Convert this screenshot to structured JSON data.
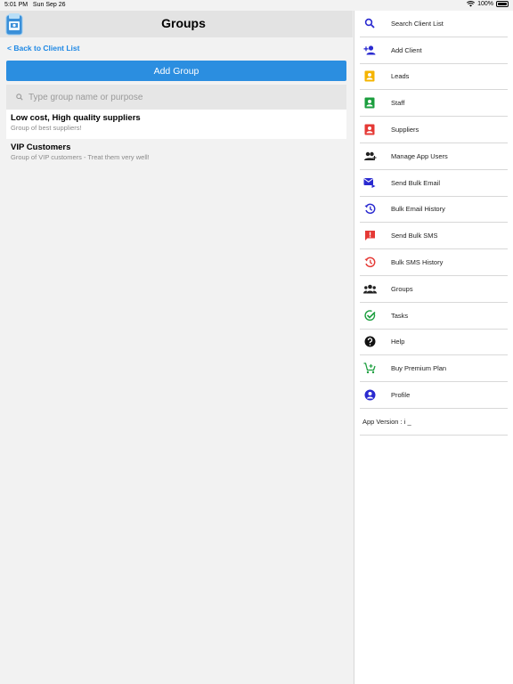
{
  "status_bar": {
    "time": "5:01 PM",
    "date": "Sun Sep 26",
    "battery": "100%"
  },
  "header": {
    "title": "Groups"
  },
  "back_link": "< Back to Client List",
  "add_group_label": "Add Group",
  "search": {
    "placeholder": "Type group name or purpose",
    "value": ""
  },
  "groups": [
    {
      "name": "Low cost, High quality suppliers",
      "description": "Group of best suppliers!"
    },
    {
      "name": "VIP Customers",
      "description": "Group of VIP customers - Treat them very well!"
    }
  ],
  "sidebar": {
    "items": [
      {
        "label": "Search Client List",
        "icon": "search-icon",
        "color": "#2a2ad0"
      },
      {
        "label": "Add Client",
        "icon": "add-person-icon",
        "color": "#2a2ad0"
      },
      {
        "label": "Leads",
        "icon": "contact-card-icon",
        "color": "#f5b400"
      },
      {
        "label": "Staff",
        "icon": "contact-card-icon",
        "color": "#1b9e3e"
      },
      {
        "label": "Suppliers",
        "icon": "contact-card-icon",
        "color": "#e53935"
      },
      {
        "label": "Manage App Users",
        "icon": "people-add-icon",
        "color": "#222222"
      },
      {
        "label": "Send Bulk Email",
        "icon": "email-send-icon",
        "color": "#2a2ad0"
      },
      {
        "label": "Bulk Email History",
        "icon": "history-icon",
        "color": "#2a2ad0"
      },
      {
        "label": "Send Bulk SMS",
        "icon": "sms-alert-icon",
        "color": "#e53935"
      },
      {
        "label": "Bulk SMS History",
        "icon": "history-icon",
        "color": "#e53935"
      },
      {
        "label": "Groups",
        "icon": "group-icon",
        "color": "#222222"
      },
      {
        "label": "Tasks",
        "icon": "task-check-icon",
        "color": "#1b9e3e"
      },
      {
        "label": "Help",
        "icon": "help-icon",
        "color": "#111111"
      },
      {
        "label": "Buy Premium Plan",
        "icon": "cart-icon",
        "color": "#1b9e3e"
      },
      {
        "label": "Profile",
        "icon": "profile-icon",
        "color": "#2a2ad0"
      }
    ],
    "version": "App Version : i _"
  },
  "colors": {
    "primary": "#2b8ee0",
    "link": "#1e88e5"
  }
}
